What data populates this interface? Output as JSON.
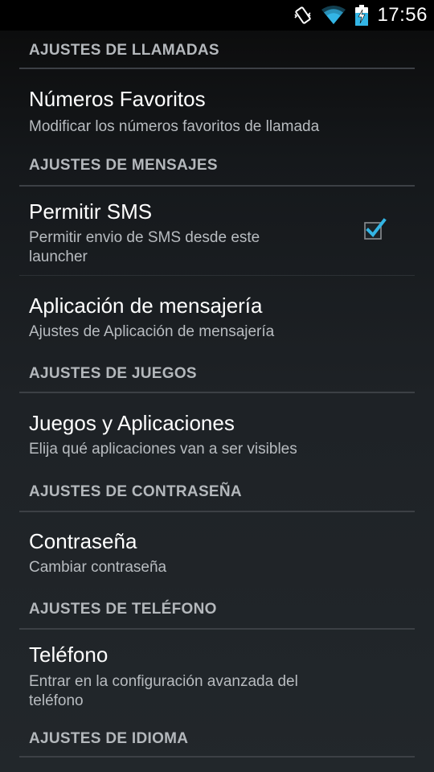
{
  "status_bar": {
    "time": "17:56",
    "icons": [
      "vibrate-icon",
      "wifi-icon",
      "battery-charging-icon"
    ]
  },
  "colors": {
    "accent": "#33b5e5",
    "category_text": "#b4b8bc",
    "summary_text": "#b8bcc0"
  },
  "sections": [
    {
      "category": "AJUSTES DE LLAMADAS",
      "items": [
        {
          "title": "Números Favoritos",
          "summary": "Modificar los números favoritos de llamada"
        }
      ]
    },
    {
      "category": "AJUSTES DE MENSAJES",
      "items": [
        {
          "title": "Permitir SMS",
          "summary_lines": [
            "Permitir envio de SMS desde este",
            "launcher"
          ],
          "checked": true
        },
        {
          "title": "Aplicación de mensajería",
          "summary": "Ajustes de Aplicación de mensajería"
        }
      ]
    },
    {
      "category": "AJUSTES DE JUEGOS",
      "items": [
        {
          "title": "Juegos y Aplicaciones",
          "summary": "Elija qué aplicaciones van a ser visibles"
        }
      ]
    },
    {
      "category": "AJUSTES DE CONTRASEÑA",
      "items": [
        {
          "title": "Contraseña",
          "summary": "Cambiar contraseña"
        }
      ]
    },
    {
      "category": "AJUSTES DE TELÉFONO",
      "items": [
        {
          "title": "Teléfono",
          "summary_lines": [
            "Entrar en la configuración avanzada del",
            "teléfono"
          ]
        }
      ]
    },
    {
      "category": "AJUSTES DE IDIOMA",
      "items": []
    }
  ]
}
